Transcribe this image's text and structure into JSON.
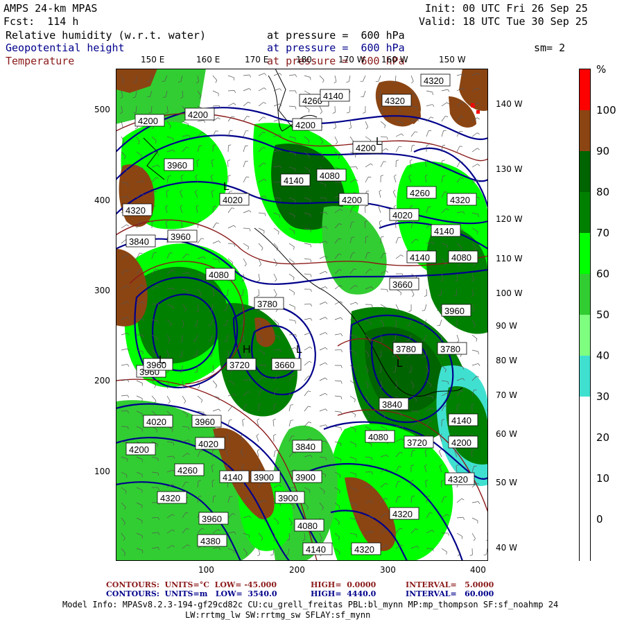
{
  "header": {
    "model": "AMPS 24-km MPAS",
    "init": "Init: 00 UTC Fri 26 Sep 25",
    "fcst": "Fcst:  114 h",
    "valid": "Valid: 18 UTC Tue 30 Sep 25"
  },
  "fields": [
    {
      "name": "Relative humidity (w.r.t. water)",
      "level": "at pressure =  600 hPa",
      "color": "#000000"
    },
    {
      "name": "Geopotential height",
      "level": "at pressure =  600 hPa",
      "color": "#00008b"
    },
    {
      "name": "Temperature",
      "level": "at pressure =  600 hPa",
      "color": "#8b1a1a"
    }
  ],
  "smoothing": "sm= 2",
  "top_lon_labels": [
    "150 E",
    "160 E",
    "170 E",
    "180",
    "170 W",
    "160 W",
    "150 W"
  ],
  "right_lon_labels": [
    "140 W",
    "130 W",
    "120 W",
    "110 W",
    "100 W",
    "90 W",
    "80 W",
    "70 W",
    "60 W",
    "50 W",
    "40 W"
  ],
  "x_ticks": [
    "100",
    "200",
    "300",
    "400"
  ],
  "y_ticks": [
    "500",
    "400",
    "300",
    "200",
    "100"
  ],
  "colorbar": {
    "unit": "%",
    "labels": [
      "100",
      "90",
      "80",
      "70",
      "60",
      "50",
      "40",
      "30",
      "20",
      "10",
      "0"
    ],
    "colors": [
      "#ff0000",
      "#8b4513",
      "#006400",
      "#008000",
      "#00ff00",
      "#32cd32",
      "#7fff7f",
      "#40e0d0",
      "#ffffff",
      "#ffffff",
      "#ffffff",
      "#ffffff"
    ]
  },
  "height_contour_labels": [
    "4200",
    "4260",
    "4320",
    "4020",
    "3960",
    "3900",
    "3840",
    "3780",
    "3720",
    "4080",
    "4140",
    "4380",
    "3660",
    "4380",
    "4320",
    "4260",
    "4200",
    "4140"
  ],
  "highs_lows": [
    "L",
    "L",
    "L",
    "L",
    "L",
    "H"
  ],
  "footer": {
    "temp_line": {
      "a": "CONTOURS:  UNITS=°C  LOW= -45.000",
      "b": "HIGH=  0.0000",
      "c": "INTERVAL=   5.0000"
    },
    "height_line": {
      "a": "CONTOURS:  UNITS=m   LOW=  3540.0",
      "b": "HIGH=  4440.0",
      "c": "INTERVAL=   60.000"
    },
    "model_info_1": "Model Info: MPASv8.2.3-194-gf29cd82c CU:cu_grell_freitas PBL:bl_mynn MP:mp_thompson SF:sf_noahmp 24",
    "model_info_2": "LW:rrtmg_lw SW:rrtmg_sw SFLAY:sf_mynn"
  }
}
